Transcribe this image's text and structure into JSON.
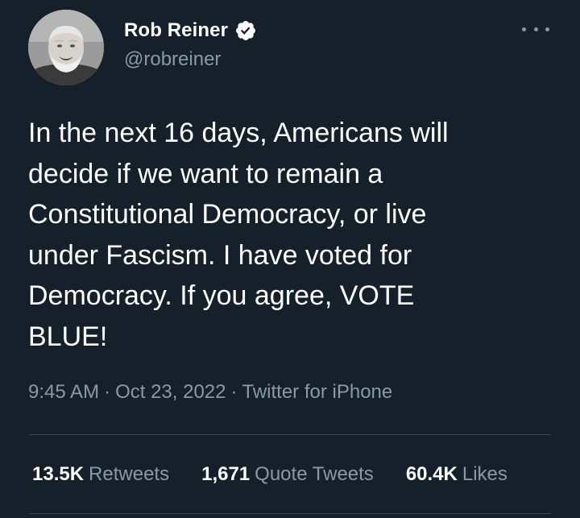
{
  "author": {
    "display_name": "Rob Reiner",
    "handle": "@robreiner",
    "verified_icon": "verified-badge-icon",
    "avatar_icon": "avatar"
  },
  "more_icon": "more-options-icon",
  "tweet": {
    "text": "In the next 16 days, Americans will\ndecide if we want to remain a\nConstitutional Democracy, or live\nunder Fascism. I have voted for\nDemocracy. If you agree, VOTE\nBLUE!",
    "time": "9:45 AM",
    "separator": "·",
    "date": "Oct 23, 2022",
    "source": "Twitter for iPhone"
  },
  "stats": {
    "retweets_count": "13.5K",
    "retweets_label": "Retweets",
    "quotes_count": "1,671",
    "quotes_label": "Quote Tweets",
    "likes_count": "60.4K",
    "likes_label": "Likes"
  },
  "colors": {
    "background": "#15202b",
    "text_primary": "#ffffff",
    "text_secondary": "#8b98a5",
    "divider": "#38444d",
    "verified_badge": "#ffffff"
  }
}
